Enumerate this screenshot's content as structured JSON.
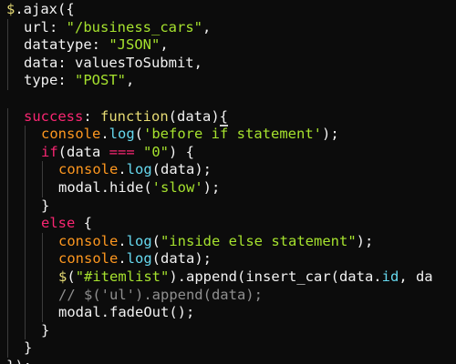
{
  "editor": {
    "lines": [
      {
        "indent": 0,
        "tokens": [
          [
            "$",
            "dollar"
          ],
          [
            ".ajax({",
            "plain"
          ]
        ]
      },
      {
        "indent": 1,
        "tokens": [
          [
            "url",
            "plain"
          ],
          [
            ": ",
            "plain"
          ],
          [
            "\"/business_cars\"",
            "string"
          ],
          [
            ",",
            "plain"
          ]
        ]
      },
      {
        "indent": 1,
        "tokens": [
          [
            "datatype",
            "plain"
          ],
          [
            ": ",
            "plain"
          ],
          [
            "\"JSON\"",
            "string"
          ],
          [
            ",",
            "plain"
          ]
        ]
      },
      {
        "indent": 1,
        "tokens": [
          [
            "data",
            "plain"
          ],
          [
            ": valuesToSubmit,",
            "plain"
          ]
        ]
      },
      {
        "indent": 1,
        "tokens": [
          [
            "type",
            "plain"
          ],
          [
            ": ",
            "plain"
          ],
          [
            "\"POST\"",
            "string"
          ],
          [
            ",",
            "plain"
          ]
        ]
      },
      {
        "indent": 0,
        "tokens": []
      },
      {
        "indent": 1,
        "tokens": [
          [
            "success",
            "keyword"
          ],
          [
            ": ",
            "plain"
          ],
          [
            "function",
            "func"
          ],
          [
            "(data)",
            "plain"
          ],
          [
            "{",
            "cursor"
          ]
        ]
      },
      {
        "indent": 2,
        "tokens": [
          [
            "console",
            "orange"
          ],
          [
            ".",
            "plain"
          ],
          [
            "log",
            "prop"
          ],
          [
            "(",
            "plain"
          ],
          [
            "'before if statement'",
            "string"
          ],
          [
            ");",
            "plain"
          ]
        ]
      },
      {
        "indent": 2,
        "tokens": [
          [
            "if",
            "keyword"
          ],
          [
            "(data ",
            "plain"
          ],
          [
            "===",
            "keyword"
          ],
          [
            " ",
            "plain"
          ],
          [
            "\"0\"",
            "string"
          ],
          [
            ") {",
            "plain"
          ]
        ]
      },
      {
        "indent": 3,
        "tokens": [
          [
            "console",
            "orange"
          ],
          [
            ".",
            "plain"
          ],
          [
            "log",
            "prop"
          ],
          [
            "(data);",
            "plain"
          ]
        ]
      },
      {
        "indent": 3,
        "tokens": [
          [
            "modal.hide(",
            "plain"
          ],
          [
            "'slow'",
            "string"
          ],
          [
            ");",
            "plain"
          ]
        ]
      },
      {
        "indent": 2,
        "tokens": [
          [
            "}",
            "plain"
          ]
        ]
      },
      {
        "indent": 2,
        "tokens": [
          [
            "else",
            "keyword"
          ],
          [
            " {",
            "plain"
          ]
        ]
      },
      {
        "indent": 3,
        "tokens": [
          [
            "console",
            "orange"
          ],
          [
            ".",
            "plain"
          ],
          [
            "log",
            "prop"
          ],
          [
            "(",
            "plain"
          ],
          [
            "\"inside else statement\"",
            "string"
          ],
          [
            ");",
            "plain"
          ]
        ]
      },
      {
        "indent": 3,
        "tokens": [
          [
            "console",
            "orange"
          ],
          [
            ".",
            "plain"
          ],
          [
            "log",
            "prop"
          ],
          [
            "(data);",
            "plain"
          ]
        ]
      },
      {
        "indent": 3,
        "tokens": [
          [
            "$",
            "dollar"
          ],
          [
            "(",
            "plain"
          ],
          [
            "\"#itemlist\"",
            "string"
          ],
          [
            ").append(insert_car(data.",
            "plain"
          ],
          [
            "id",
            "prop"
          ],
          [
            ", da",
            "plain"
          ]
        ]
      },
      {
        "indent": 3,
        "tokens": [
          [
            "// $('ul').append(data);",
            "comment"
          ]
        ]
      },
      {
        "indent": 3,
        "tokens": [
          [
            "modal.fadeOut();",
            "plain"
          ]
        ]
      },
      {
        "indent": 2,
        "tokens": [
          [
            "}",
            "plain"
          ]
        ]
      },
      {
        "indent": 1,
        "tokens": [
          [
            "}",
            "plain"
          ]
        ]
      },
      {
        "indent": 0,
        "tokens": [
          [
            "});",
            "plain"
          ]
        ]
      }
    ]
  }
}
